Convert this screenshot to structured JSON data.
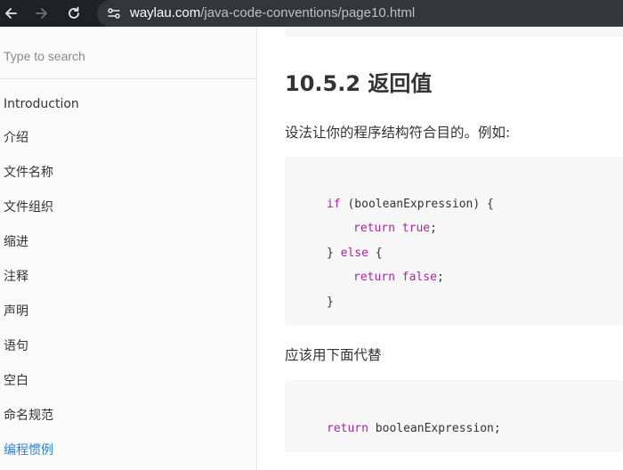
{
  "browser": {
    "url_host": "waylau.com",
    "url_path": "/java-code-conventions/page10.html"
  },
  "sidebar": {
    "search_placeholder": "Type to search",
    "items": [
      {
        "label": "Introduction"
      },
      {
        "label": "介绍"
      },
      {
        "label": "文件名称"
      },
      {
        "label": "文件组织"
      },
      {
        "label": "缩进"
      },
      {
        "label": "注释"
      },
      {
        "label": "声明"
      },
      {
        "label": "语句"
      },
      {
        "label": "空白"
      },
      {
        "label": "命名规范"
      },
      {
        "label": "编程惯例"
      }
    ],
    "active_color": "#2e80d1"
  },
  "content": {
    "heading": "10.5.2 返回值",
    "intro": "设法让你的程序结构符合目的。例如:",
    "code1": {
      "line1": {
        "kw": "if",
        "rest": " (booleanExpression) {"
      },
      "line2": {
        "kw": "return",
        "space": " ",
        "lit": "true",
        "end": ";"
      },
      "line3": {
        "pre": "} ",
        "kw": "else",
        "rest": " {"
      },
      "line4": {
        "kw": "return",
        "space": " ",
        "lit": "false",
        "end": ";"
      },
      "line5": {
        "text": "}"
      }
    },
    "instead": "应该用下面代替",
    "code2": {
      "line1": {
        "kw": "return",
        "rest": " booleanExpression;"
      }
    }
  }
}
